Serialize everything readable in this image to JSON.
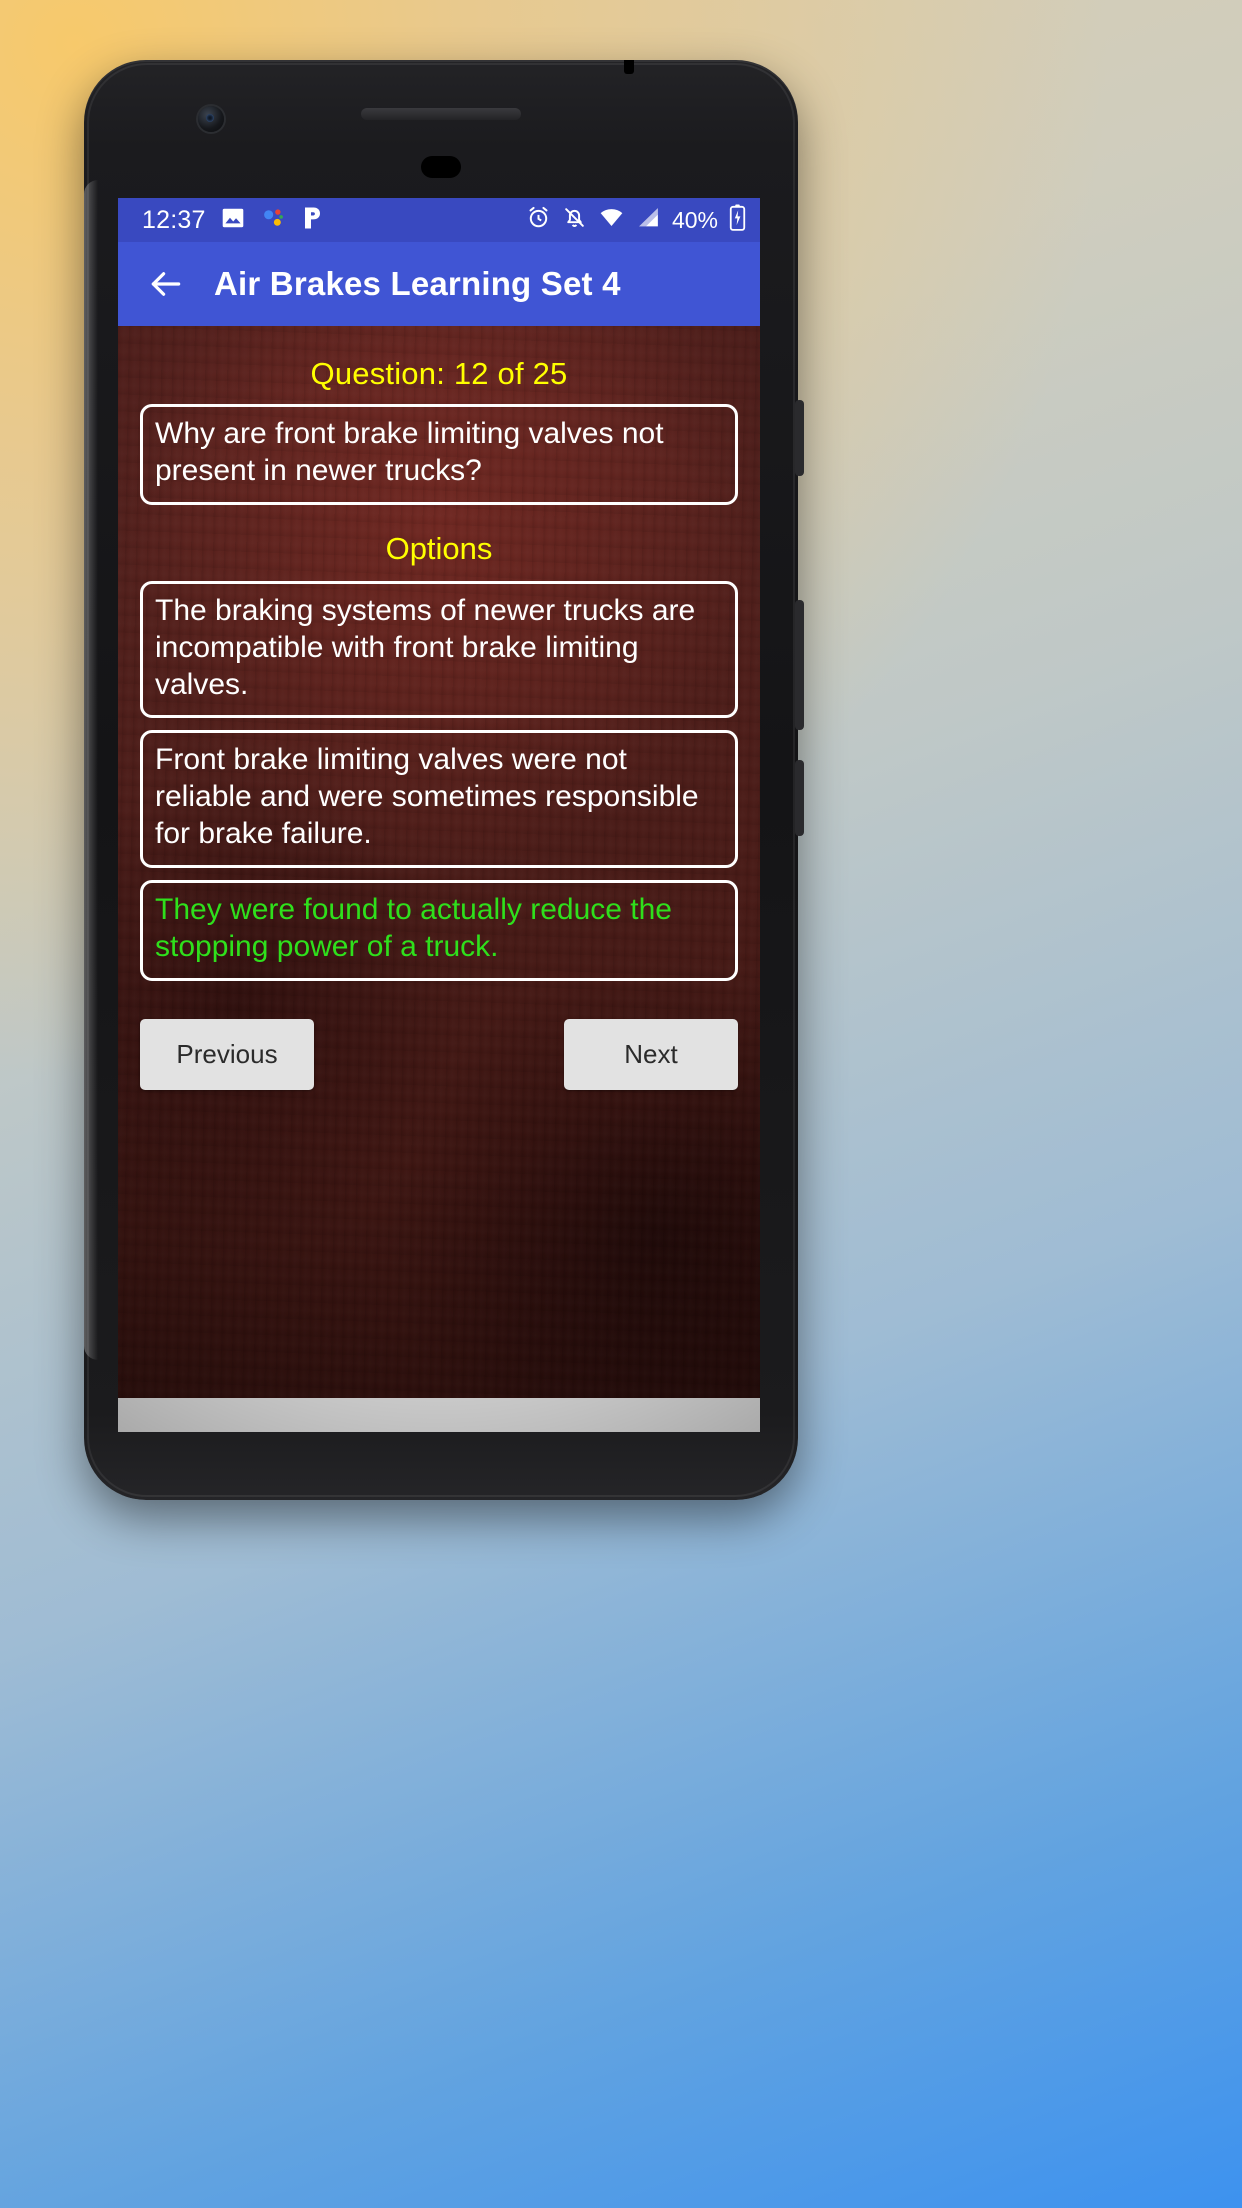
{
  "statusbar": {
    "time": "12:37",
    "left_icons": [
      "image-icon",
      "google-assistant-icon",
      "pandora-icon"
    ],
    "right_icons": [
      "alarm-icon",
      "notifications-off-icon",
      "wifi-icon",
      "cellular-signal-icon"
    ],
    "battery_percent": "40%"
  },
  "appbar": {
    "back_icon": "back-arrow-icon",
    "title": "Air Brakes Learning Set 4",
    "bg_color": "#4055d4"
  },
  "quiz": {
    "counter": "Question: 12 of 25",
    "question": "Why are front brake limiting valves not present in newer trucks?",
    "options_label": "Options",
    "options": [
      {
        "text": "The braking systems of newer trucks are incompatible with front brake limiting valves.",
        "correct": false
      },
      {
        "text": "Front brake limiting valves were not reliable and were sometimes responsible for brake failure.",
        "correct": false
      },
      {
        "text": "They were found to actually reduce the stopping power of a truck.",
        "correct": true
      }
    ],
    "previous_label": "Previous",
    "next_label": "Next",
    "accent_yellow": "#ffff00",
    "correct_green": "#2fe01c"
  }
}
